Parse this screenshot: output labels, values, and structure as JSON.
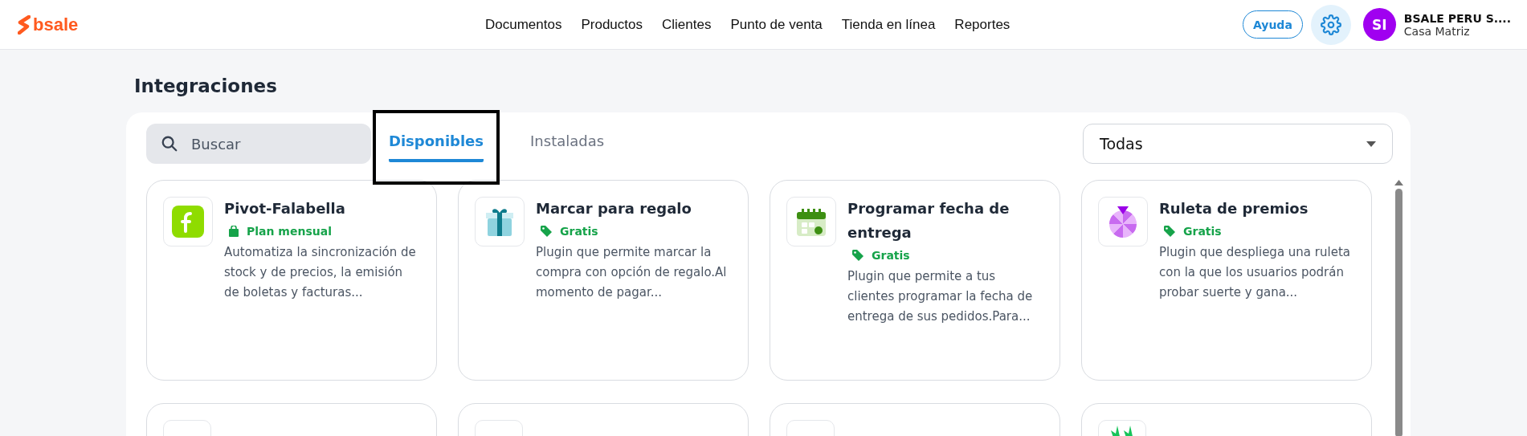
{
  "header": {
    "logo": "bsale",
    "nav": [
      "Documentos",
      "Productos",
      "Clientes",
      "Punto de venta",
      "Tienda en línea",
      "Reportes"
    ],
    "help_button": "Ayuda",
    "user": {
      "initials": "SI",
      "name": "BSALE PERU S....",
      "branch": "Casa Matriz"
    }
  },
  "page_title": "Integraciones",
  "search": {
    "placeholder": "Buscar"
  },
  "tabs": [
    {
      "label": "Disponibles",
      "selected": true,
      "highlighted": true
    },
    {
      "label": "Instaladas",
      "selected": false,
      "highlighted": false
    }
  ],
  "filter": {
    "value": "Todas"
  },
  "cards": [
    {
      "kind": "falabella",
      "title": "Pivot-Falabella",
      "badge": {
        "kind": "plan",
        "label": "Plan mensual"
      },
      "description": "Automatiza la sincronización de stock y de precios, la emisión de boletas y facturas..."
    },
    {
      "kind": "gift",
      "title": "Marcar para regalo",
      "badge": {
        "kind": "free",
        "label": "Gratis"
      },
      "description": "Plugin que permite marcar la compra con opción de regalo.Al momento de pagar..."
    },
    {
      "kind": "calendar",
      "title": "Programar fecha de entrega",
      "badge": {
        "kind": "free",
        "label": "Gratis"
      },
      "description": "Plugin que permite a tus clientes programar la fecha de entrega de sus pedidos.Para..."
    },
    {
      "kind": "wheel",
      "title": "Ruleta de premios",
      "badge": {
        "kind": "free",
        "label": "Gratis"
      },
      "description": "Plugin que despliega una ruleta con la que los usuarios podrán probar suerte y gana..."
    }
  ],
  "more_cards": [
    {
      "kind": "plain"
    },
    {
      "kind": "plain"
    },
    {
      "kind": "plain"
    },
    {
      "kind": "leaf"
    }
  ]
}
